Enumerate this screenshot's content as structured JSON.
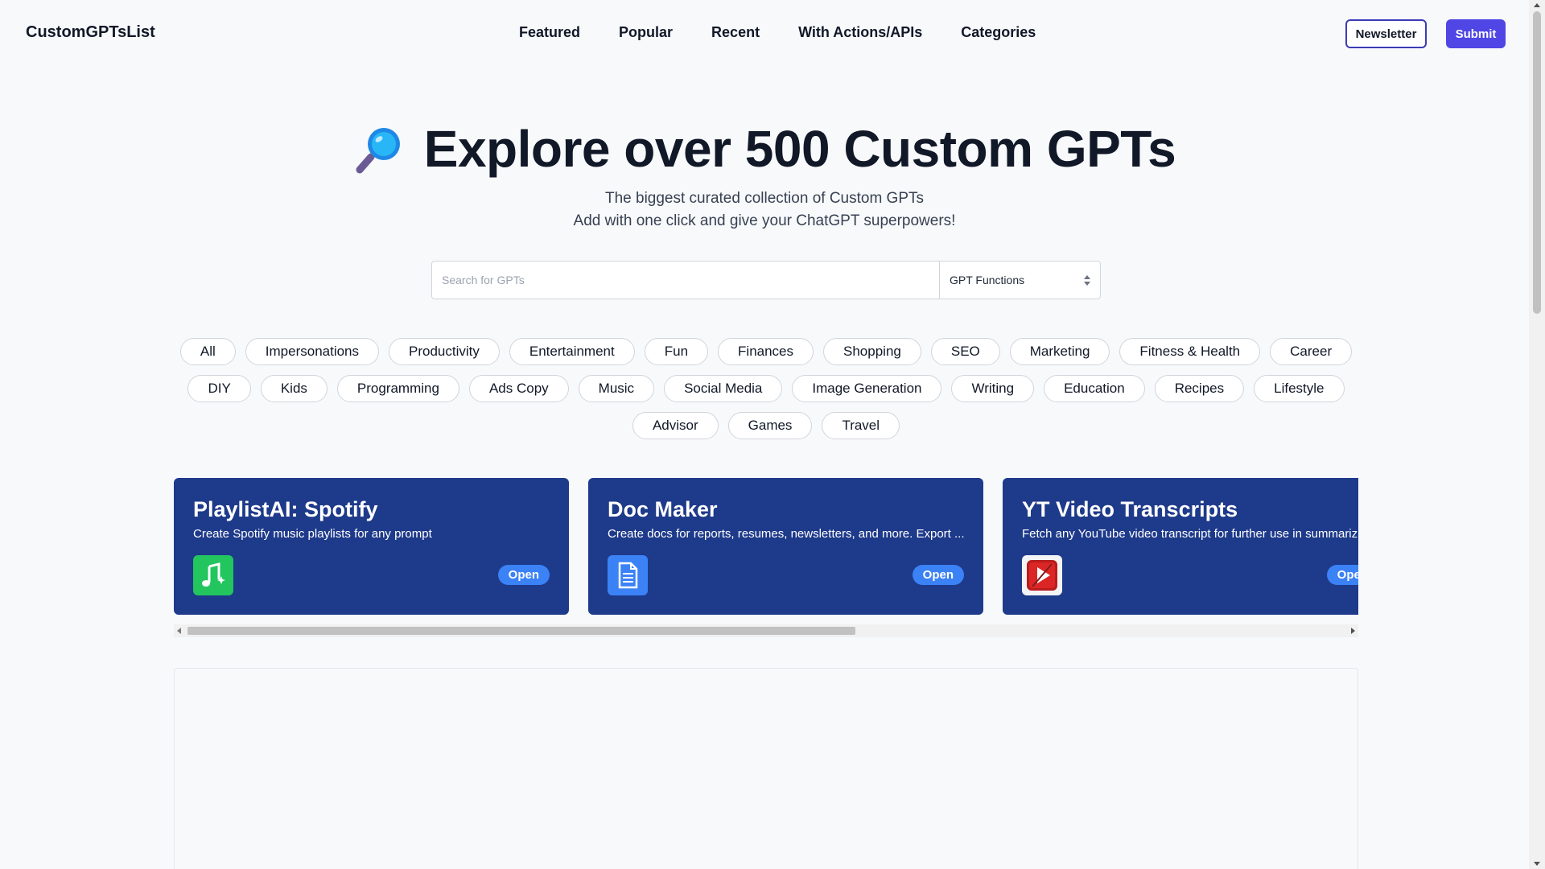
{
  "header": {
    "logo": "CustomGPTsList",
    "nav": [
      {
        "label": "Featured"
      },
      {
        "label": "Popular"
      },
      {
        "label": "Recent"
      },
      {
        "label": "With Actions/APIs"
      },
      {
        "label": "Categories"
      }
    ],
    "newsletter_label": "Newsletter",
    "submit_label": "Submit"
  },
  "hero": {
    "icon": "magnifying-glass-icon",
    "title": "Explore over 500 Custom GPTs",
    "subtitle_line1": "The biggest curated collection of Custom GPTs",
    "subtitle_line2": "Add with one click and give your ChatGPT superpowers!"
  },
  "search": {
    "placeholder": "Search for GPTs",
    "value": "",
    "select_value": "GPT Functions"
  },
  "categories": [
    "All",
    "Impersonations",
    "Productivity",
    "Entertainment",
    "Fun",
    "Finances",
    "Shopping",
    "SEO",
    "Marketing",
    "Fitness & Health",
    "Career",
    "DIY",
    "Kids",
    "Programming",
    "Ads Copy",
    "Music",
    "Social Media",
    "Image Generation",
    "Writing",
    "Education",
    "Recipes",
    "Lifestyle",
    "Advisor",
    "Games",
    "Travel"
  ],
  "featured_cards": [
    {
      "title": "PlaylistAI: Spotify",
      "description": "Create Spotify music playlists for any prompt",
      "icon": "music-note-sparkle-icon",
      "icon_color": "#22c55e",
      "open_label": "Open"
    },
    {
      "title": "Doc Maker",
      "description": "Create docs for reports, resumes, newsletters, and more. Export ...",
      "icon": "document-icon",
      "icon_color": "#3b82f6",
      "open_label": "Open"
    },
    {
      "title": "YT Video Transcripts",
      "description": "Fetch any YouTube video transcript for further use in summarizing",
      "icon": "video-play-icon",
      "icon_color": "#dc2626",
      "open_label": "Open"
    }
  ],
  "colors": {
    "accent": "#4f46e5",
    "card_bg": "#1e3a8a",
    "open_button": "#3b82f6",
    "page_bg": "#f8f9fb"
  }
}
